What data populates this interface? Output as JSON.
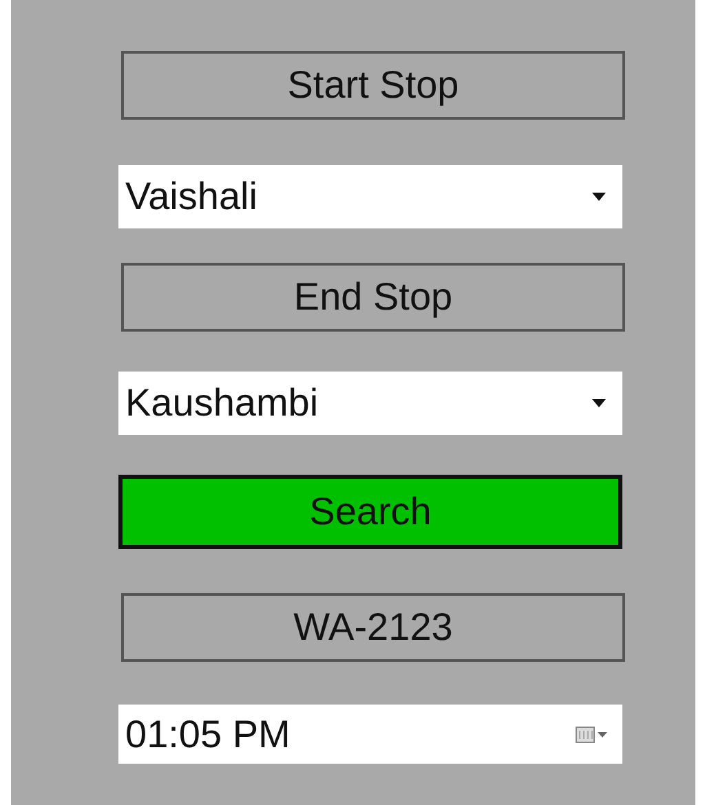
{
  "controls": [
    {
      "kind": "label",
      "text": "Start Stop"
    },
    {
      "kind": "dropdown",
      "value": "Vaishali"
    },
    {
      "kind": "label",
      "text": "End Stop"
    },
    {
      "kind": "dropdown",
      "value": "Kaushambi"
    },
    {
      "kind": "button",
      "text": "Search"
    },
    {
      "kind": "label",
      "text": "WA-2123"
    },
    {
      "kind": "time",
      "value": "01:05 PM"
    }
  ]
}
